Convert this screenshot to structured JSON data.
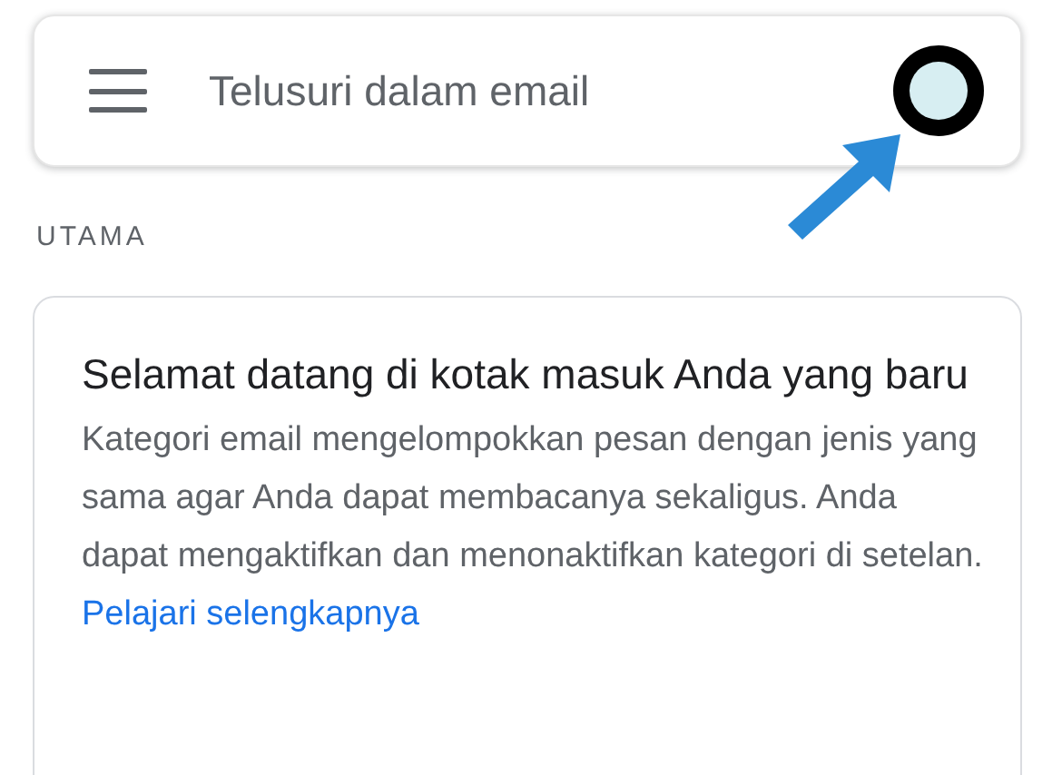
{
  "search": {
    "placeholder": "Telusuri dalam email"
  },
  "section_label": "UTAMA",
  "card": {
    "title": "Selamat datang di kotak masuk Anda yang baru",
    "body": "Kategori email mengelompokkan pesan dengan jenis yang sama agar Anda dapat membacanya sekaligus. Anda dapat mengaktifkan dan menonaktifkan kategori di setelan.",
    "link": "Pelajari selengkapnya"
  }
}
